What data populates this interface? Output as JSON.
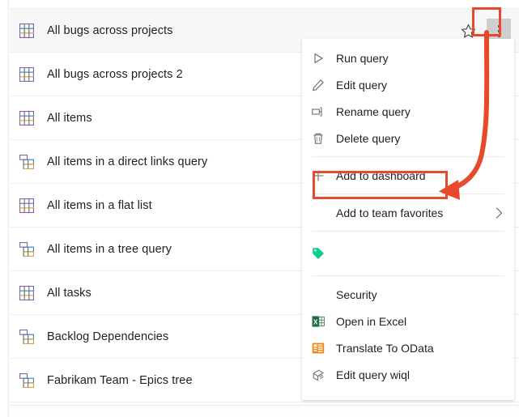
{
  "colors": {
    "annotation_red": "#E8492C",
    "selected_row_bg": "#f7f7f7",
    "more_button_bg": "#cfcfcf",
    "excel_green": "#1D7044",
    "odata_orange": "#F2820D",
    "tag_green": "#0FD08A"
  },
  "query_list": {
    "rows": [
      {
        "icon": "flat-query-icon",
        "label": "All bugs across projects",
        "selected": true,
        "has_actions": true
      },
      {
        "icon": "flat-query-icon",
        "label": "All bugs across projects 2",
        "selected": false,
        "has_actions": false
      },
      {
        "icon": "flat-query-icon",
        "label": "All items",
        "selected": false,
        "has_actions": false
      },
      {
        "icon": "tree-query-icon",
        "label": "All items in a direct links query",
        "selected": false,
        "has_actions": false
      },
      {
        "icon": "flat-query-icon",
        "label": "All items in a flat list",
        "selected": false,
        "has_actions": false
      },
      {
        "icon": "tree-query-icon",
        "label": "All items in a tree query",
        "selected": false,
        "has_actions": false
      },
      {
        "icon": "flat-query-icon",
        "label": "All tasks",
        "selected": false,
        "has_actions": false
      },
      {
        "icon": "tree-query-icon",
        "label": "Backlog Dependencies",
        "selected": false,
        "has_actions": false
      },
      {
        "icon": "tree-query-icon",
        "label": "Fabrikam Team - Epics tree",
        "selected": false,
        "has_actions": false
      }
    ],
    "row_actions": {
      "favorite_icon": "star-outline-icon",
      "more_icon": "more-vertical-icon"
    }
  },
  "context_menu": {
    "items": [
      {
        "type": "item",
        "icon": "play-triangle-icon",
        "label": "Run query"
      },
      {
        "type": "item",
        "icon": "pencil-icon",
        "label": "Edit query"
      },
      {
        "type": "item",
        "icon": "rename-icon",
        "label": "Rename query"
      },
      {
        "type": "item",
        "icon": "trash-icon",
        "label": "Delete query"
      },
      {
        "type": "separator"
      },
      {
        "type": "item",
        "icon": "plus-icon",
        "label": "Add to dashboard",
        "highlighted": true
      },
      {
        "type": "separator"
      },
      {
        "type": "item",
        "icon": "none",
        "label": "Add to team favorites",
        "submenu": true
      },
      {
        "type": "separator"
      },
      {
        "type": "item",
        "icon": "tag-icon",
        "label": ""
      },
      {
        "type": "separator"
      },
      {
        "type": "item",
        "icon": "none",
        "label": "Security"
      },
      {
        "type": "item",
        "icon": "excel-icon",
        "label": "Open in Excel"
      },
      {
        "type": "item",
        "icon": "odata-icon",
        "label": "Translate To OData"
      },
      {
        "type": "item",
        "icon": "wiql-icon",
        "label": "Edit query wiql"
      }
    ]
  },
  "annotations": {
    "more_button_highlight": "more-vertical-button",
    "add_to_dashboard_highlight": "Add to dashboard",
    "arrow": "curved-arrow-from-more-button-to-add-to-dashboard"
  }
}
